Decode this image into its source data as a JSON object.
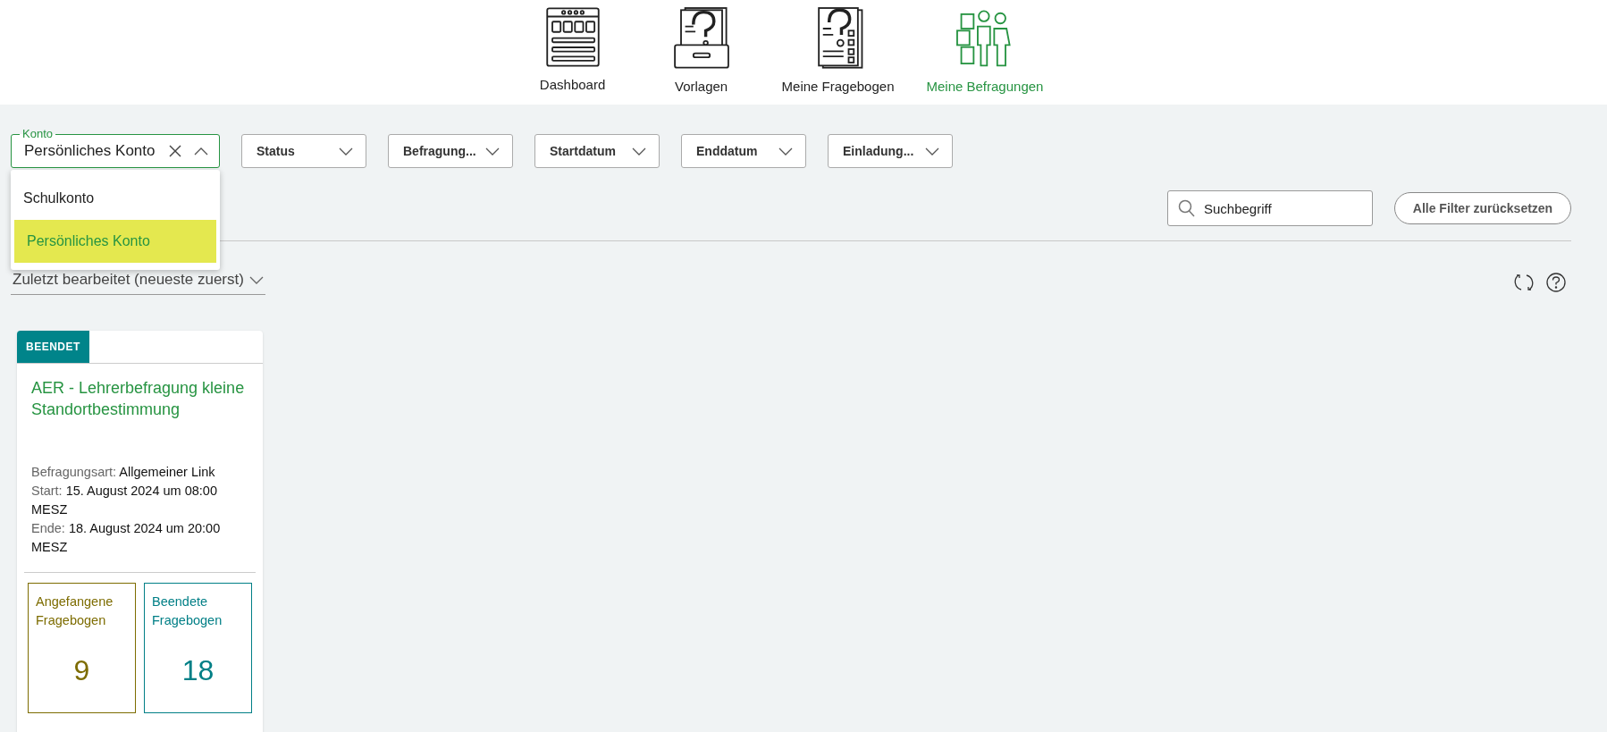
{
  "nav": [
    {
      "label": "Dashboard",
      "kind": "dashboard",
      "selected": false
    },
    {
      "label": "Vorlagen",
      "kind": "templates",
      "selected": false
    },
    {
      "label": "Meine Fragebogen",
      "kind": "questionnaires",
      "selected": false
    },
    {
      "label": "Meine Befragungen",
      "kind": "surveys",
      "selected": true
    }
  ],
  "account_filter": {
    "label": "Konto",
    "value": "Persönliches Konto",
    "expanded": true,
    "options": [
      {
        "label": "Schulkonto",
        "selected": false
      },
      {
        "label": "Persönliches Konto",
        "selected": true
      }
    ]
  },
  "filters": [
    "Status",
    "Befragung...",
    "Startdatum",
    "Enddatum",
    "Einladung..."
  ],
  "search": {
    "placeholder": "Suchbegriff"
  },
  "reset_button": "Alle Filter zurücksetzen",
  "sort": "Zuletzt bearbeitet (neueste zuerst)",
  "cards": [
    {
      "status": "BEENDET",
      "title": "AER - Lehrerbefragung kleine Standortbestimmung",
      "details": [
        {
          "label": "Befragungsart:",
          "value": "Allgemeiner Link"
        },
        {
          "label": "Start:",
          "value": "15. August 2024 um 08:00 MESZ"
        },
        {
          "label": "Ende:",
          "value": "18. August 2024 um 20:00 MESZ"
        }
      ],
      "stats": [
        {
          "label": "Angefangene Fragebogen",
          "value": "9",
          "color": "#7d6c00"
        },
        {
          "label": "Beendete Fragebogen",
          "value": "18",
          "color": "#007f86"
        }
      ]
    }
  ]
}
